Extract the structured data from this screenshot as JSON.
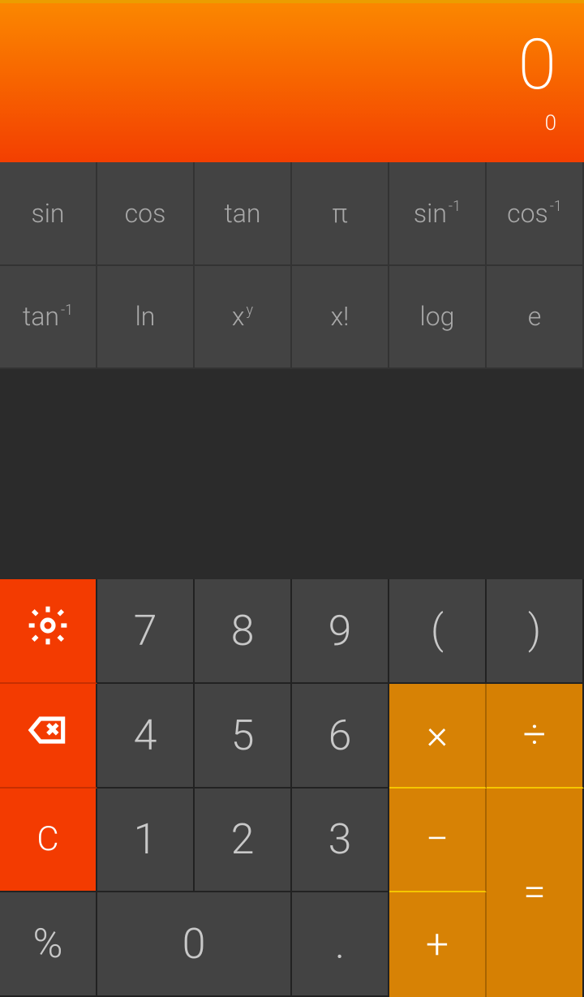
{
  "display": {
    "main": "0",
    "sub": "0"
  },
  "sci": {
    "sin": "sin",
    "cos": "cos",
    "tan": "tan",
    "pi": "π",
    "asin_base": "sin",
    "asin_sup": "-1",
    "acos_base": "cos",
    "acos_sup": "-1",
    "atan_base": "tan",
    "atan_sup": "-1",
    "ln": "ln",
    "pow_base": "x",
    "pow_sup": "y",
    "fact": "x!",
    "log": "log",
    "e": "e"
  },
  "keys": {
    "k7": "7",
    "k8": "8",
    "k9": "9",
    "lparen": "(",
    "rparen": ")",
    "k4": "4",
    "k5": "5",
    "k6": "6",
    "mul": "×",
    "div": "÷",
    "clear": "C",
    "k1": "1",
    "k2": "2",
    "k3": "3",
    "minus": "−",
    "percent": "%",
    "k0": "0",
    "dot": ".",
    "plus": "+",
    "eq": "="
  }
}
